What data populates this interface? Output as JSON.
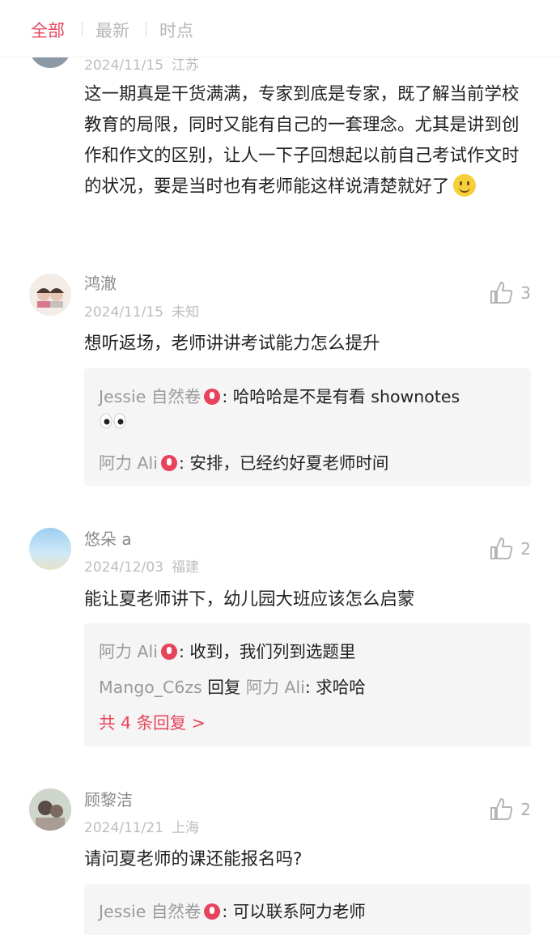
{
  "tabs": [
    {
      "label": "全部"
    },
    {
      "label": "最新"
    },
    {
      "label": "时点"
    }
  ],
  "comments": [
    {
      "name": "",
      "date": "2024/11/15",
      "location": "江苏",
      "text": "这一期真是干货满满，专家到底是专家，既了解当前学校教育的局限，同时又能有自己的一套理念。尤其是讲到创作和作文的区别，让人一下子回想起以前自己考试作文时的状况，要是当时也有老师能这样说清楚就好了"
    },
    {
      "name": "鸿澈",
      "date": "2024/11/15",
      "location": "未知",
      "likes": "3",
      "text": "想听返场，老师讲讲考试能力怎么提升",
      "replies": [
        {
          "author": "Jessie 自然卷",
          "text": "哈哈哈是不是有看 shownotes"
        },
        {
          "author": "阿力 Ali",
          "text": "安排，已经约好夏老师时间"
        }
      ]
    },
    {
      "name": "悠朵 a",
      "date": "2024/12/03",
      "location": "福建",
      "likes": "2",
      "text": "能让夏老师讲下，幼儿园大班应该怎么启蒙",
      "replies": [
        {
          "author": "阿力 Ali",
          "text": "收到，我们列到选题里"
        },
        {
          "author": "Mango_C6zs",
          "mid": "回复",
          "target": "阿力 Ali",
          "text": "求哈哈"
        }
      ],
      "more": "共 4 条回复 >"
    },
    {
      "name": "顾黎洁",
      "date": "2024/11/21",
      "location": "上海",
      "likes": "2",
      "text": "请问夏老师的课还能报名吗?",
      "replies": [
        {
          "author": "Jessie 自然卷",
          "text": "可以联系阿力老师"
        }
      ]
    }
  ],
  "colors": {
    "accent": "#e8435c",
    "muted": "#9a9a9a",
    "reply_bg": "#f5f5f5"
  }
}
